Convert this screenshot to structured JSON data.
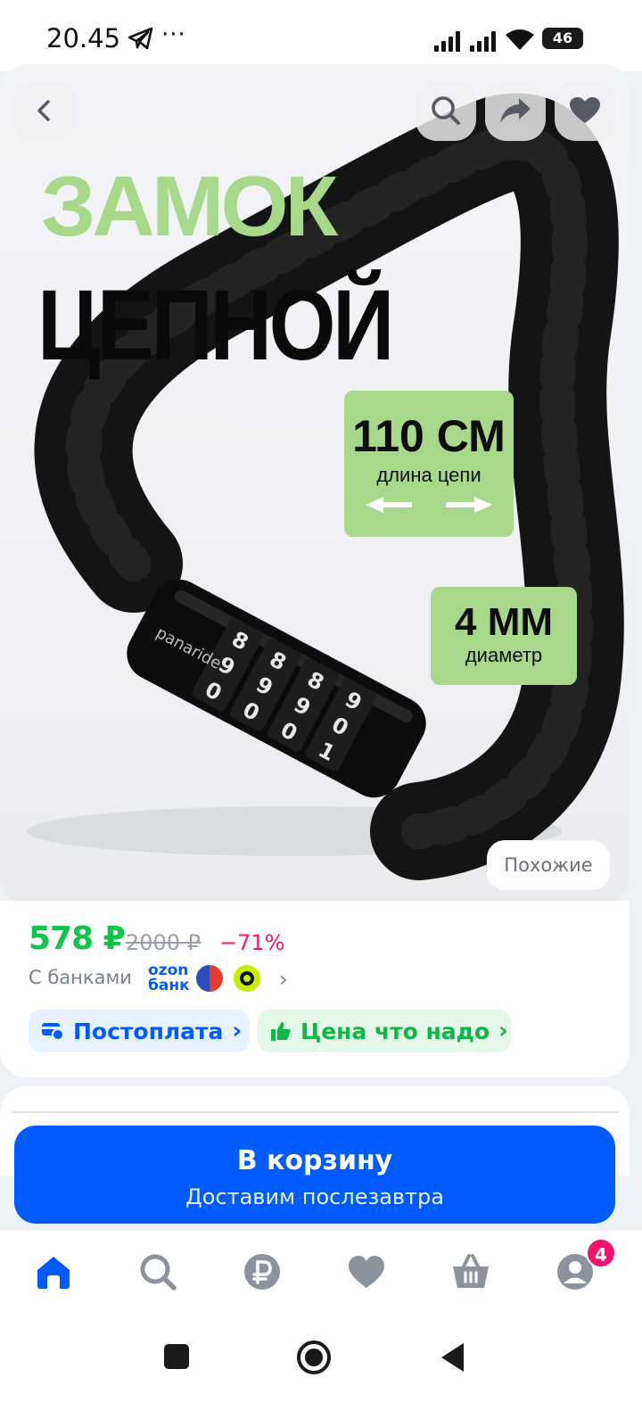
{
  "status_bar": {
    "time": "20.45",
    "dots": "···",
    "battery": "46"
  },
  "product_image": {
    "title_line1": "ЗАМОК",
    "title_line2": "ЦЕПНОЙ",
    "length_value": "110 СМ",
    "length_caption": "длина цепи",
    "diameter_value": "4 ММ",
    "diameter_caption": "диаметр",
    "brand": "panaride",
    "similar_label": "Похожие",
    "accent_color": "#a8d88a"
  },
  "top_buttons": {
    "back_icon": "chevron-left-icon",
    "search_icon": "search-icon",
    "share_icon": "share-icon",
    "favorite_icon": "heart-icon"
  },
  "price_block": {
    "price": "578 ₽",
    "old_price": "2000 ₽",
    "discount": "−71%",
    "banks_label": "С банками",
    "ozon_bank_line1": "ozon",
    "ozon_bank_line2": "банк",
    "banks_chevron": "›",
    "chip_postpay": "Постоплата",
    "chip_price": "Цена что надо",
    "chip_arrow": "›",
    "price_color": "#10c44c",
    "discount_color": "#f21866"
  },
  "cart_button": {
    "label": "В корзину",
    "sublabel": "Доставим послезавтра",
    "color": "#005bff"
  },
  "bottom_nav": {
    "items": [
      {
        "icon": "home-icon",
        "active": true
      },
      {
        "icon": "search-icon",
        "active": false
      },
      {
        "icon": "ruble-icon",
        "active": false
      },
      {
        "icon": "heart-icon",
        "active": false
      },
      {
        "icon": "basket-icon",
        "active": false
      },
      {
        "icon": "profile-icon",
        "active": false
      }
    ],
    "profile_badge": "4"
  },
  "system_nav": {
    "items": [
      "recents-icon",
      "home-circle-icon",
      "back-triangle-icon"
    ]
  }
}
